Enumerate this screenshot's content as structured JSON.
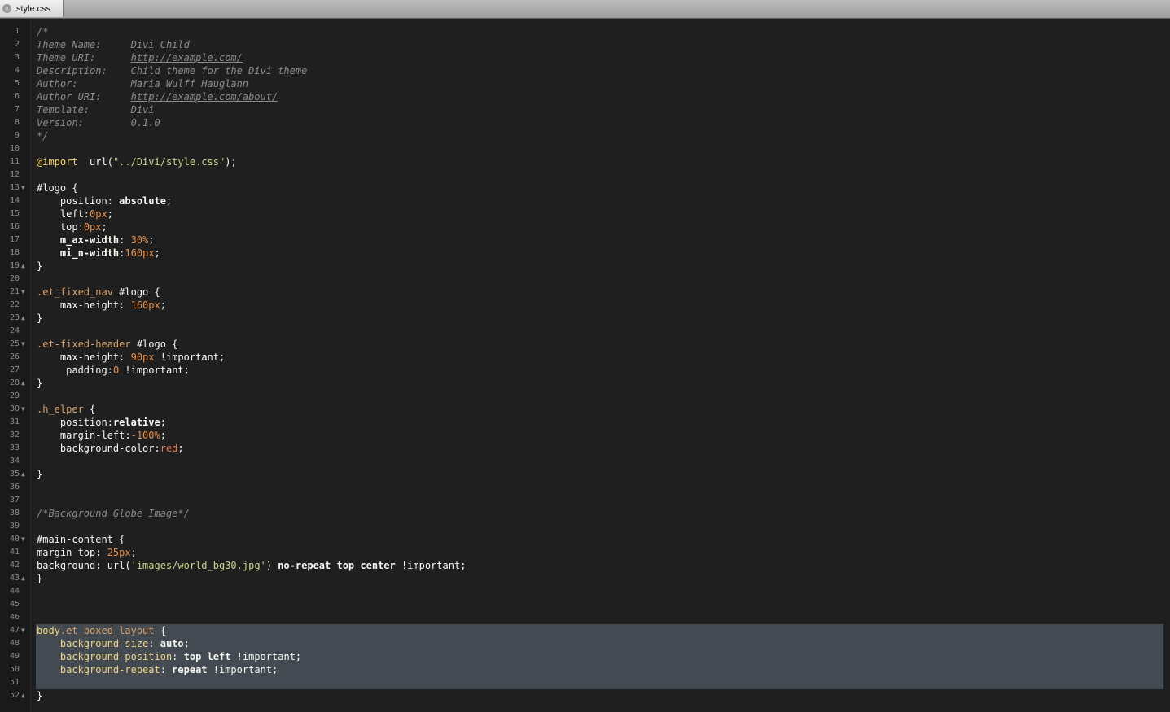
{
  "tab": {
    "title": "style.css",
    "close_glyph": "×"
  },
  "editor": {
    "line_count": 52,
    "fold_open_lines": [
      13,
      21,
      25,
      30,
      40,
      47
    ],
    "fold_close_lines": [
      19,
      23,
      28,
      35,
      43,
      52
    ],
    "selection_lines": [
      47,
      51
    ],
    "lines": [
      {
        "n": 1,
        "t": [
          [
            "c",
            "/*"
          ]
        ]
      },
      {
        "n": 2,
        "t": [
          [
            "c",
            "Theme Name:     Divi Child"
          ]
        ]
      },
      {
        "n": 3,
        "t": [
          [
            "c",
            "Theme URI:      "
          ],
          [
            "c u",
            "http://example.com/"
          ]
        ]
      },
      {
        "n": 4,
        "t": [
          [
            "c",
            "Description:    Child theme for the Divi theme"
          ]
        ]
      },
      {
        "n": 5,
        "t": [
          [
            "c",
            "Author:         Maria Wulff Hauglann"
          ]
        ]
      },
      {
        "n": 6,
        "t": [
          [
            "c",
            "Author URI:     "
          ],
          [
            "c u",
            "http://example.com/about/"
          ]
        ]
      },
      {
        "n": 7,
        "t": [
          [
            "c",
            "Template:       Divi"
          ]
        ]
      },
      {
        "n": 8,
        "t": [
          [
            "c",
            "Version:        0.1.0"
          ]
        ]
      },
      {
        "n": 9,
        "t": [
          [
            "c",
            "*/"
          ]
        ]
      },
      {
        "n": 10,
        "t": []
      },
      {
        "n": 11,
        "t": [
          [
            "at",
            "@import"
          ],
          [
            "",
            "  url("
          ],
          [
            "s",
            "\"../Divi/style.css\""
          ],
          [
            "",
            ");"
          ]
        ]
      },
      {
        "n": 12,
        "t": []
      },
      {
        "n": 13,
        "t": [
          [
            "sel-id",
            "#logo"
          ],
          [
            "",
            " {"
          ]
        ]
      },
      {
        "n": 14,
        "t": [
          [
            "prop",
            "    position"
          ],
          [
            "",
            ": "
          ],
          [
            "val",
            "absolute"
          ],
          [
            "",
            ";"
          ]
        ]
      },
      {
        "n": 15,
        "t": [
          [
            "prop",
            "    left"
          ],
          [
            "",
            ":"
          ],
          [
            "num",
            "0px"
          ],
          [
            "",
            ";"
          ]
        ]
      },
      {
        "n": 16,
        "t": [
          [
            "prop",
            "    top"
          ],
          [
            "",
            ":"
          ],
          [
            "num",
            "0px"
          ],
          [
            "",
            ";"
          ]
        ]
      },
      {
        "n": 17,
        "t": [
          [
            "val",
            "    m_ax-width"
          ],
          [
            "",
            ": "
          ],
          [
            "num",
            "30%"
          ],
          [
            "",
            ";"
          ]
        ]
      },
      {
        "n": 18,
        "t": [
          [
            "val",
            "    mi_n-width"
          ],
          [
            "",
            ":"
          ],
          [
            "num",
            "160px"
          ],
          [
            "",
            ";"
          ]
        ]
      },
      {
        "n": 19,
        "t": [
          [
            "",
            "}"
          ]
        ]
      },
      {
        "n": 20,
        "t": []
      },
      {
        "n": 21,
        "t": [
          [
            "cls",
            ".et_fixed_nav"
          ],
          [
            "sel-id",
            " #logo"
          ],
          [
            "",
            " {"
          ]
        ]
      },
      {
        "n": 22,
        "t": [
          [
            "prop",
            "    max-height"
          ],
          [
            "",
            ": "
          ],
          [
            "num",
            "160px"
          ],
          [
            "",
            ";"
          ]
        ]
      },
      {
        "n": 23,
        "t": [
          [
            "",
            "}"
          ]
        ]
      },
      {
        "n": 24,
        "t": []
      },
      {
        "n": 25,
        "t": [
          [
            "cls",
            ".et-fixed-header"
          ],
          [
            "sel-id",
            " #logo"
          ],
          [
            "",
            " {"
          ]
        ]
      },
      {
        "n": 26,
        "t": [
          [
            "prop",
            "    max-height"
          ],
          [
            "",
            ": "
          ],
          [
            "num",
            "90px"
          ],
          [
            "imp",
            " !important"
          ],
          [
            "",
            ";"
          ]
        ]
      },
      {
        "n": 27,
        "t": [
          [
            "prop",
            "     padding"
          ],
          [
            "",
            ":"
          ],
          [
            "num",
            "0"
          ],
          [
            "imp",
            " !important"
          ],
          [
            "",
            ";"
          ]
        ]
      },
      {
        "n": 28,
        "t": [
          [
            "",
            "}"
          ]
        ]
      },
      {
        "n": 29,
        "t": []
      },
      {
        "n": 30,
        "t": [
          [
            "cls",
            ".h_elper"
          ],
          [
            "",
            " {"
          ]
        ]
      },
      {
        "n": 31,
        "t": [
          [
            "prop",
            "    position"
          ],
          [
            "",
            ":"
          ],
          [
            "val",
            "relative"
          ],
          [
            "",
            ";"
          ]
        ]
      },
      {
        "n": 32,
        "t": [
          [
            "prop",
            "    margin-left"
          ],
          [
            "",
            ":"
          ],
          [
            "num",
            "-100%"
          ],
          [
            "",
            ";"
          ]
        ]
      },
      {
        "n": 33,
        "t": [
          [
            "prop",
            "    background-color"
          ],
          [
            "",
            ":"
          ],
          [
            "red",
            "red"
          ],
          [
            "",
            ";"
          ]
        ]
      },
      {
        "n": 34,
        "t": []
      },
      {
        "n": 35,
        "t": [
          [
            "",
            "}"
          ]
        ]
      },
      {
        "n": 36,
        "t": []
      },
      {
        "n": 37,
        "t": []
      },
      {
        "n": 38,
        "t": [
          [
            "c",
            "/*Background Globe Image*/"
          ]
        ]
      },
      {
        "n": 39,
        "t": []
      },
      {
        "n": 40,
        "t": [
          [
            "sel-id",
            "#main-content"
          ],
          [
            "",
            " {"
          ]
        ]
      },
      {
        "n": 41,
        "t": [
          [
            "prop",
            "margin-top"
          ],
          [
            "",
            ": "
          ],
          [
            "num",
            "25px"
          ],
          [
            "",
            ";"
          ]
        ]
      },
      {
        "n": 42,
        "t": [
          [
            "prop",
            "background"
          ],
          [
            "",
            ": url("
          ],
          [
            "s",
            "'images/world_bg30.jpg'"
          ],
          [
            "",
            ") "
          ],
          [
            "val",
            "no-repeat top center"
          ],
          [
            "imp",
            " !important"
          ],
          [
            "",
            ";"
          ]
        ]
      },
      {
        "n": 43,
        "t": [
          [
            "",
            "}"
          ]
        ]
      },
      {
        "n": 44,
        "t": []
      },
      {
        "n": 45,
        "t": []
      },
      {
        "n": 46,
        "t": []
      },
      {
        "n": 47,
        "t": [
          [
            "tag",
            "body"
          ],
          [
            "cls",
            ".et_boxed_layout"
          ],
          [
            "",
            " {"
          ]
        ]
      },
      {
        "n": 48,
        "t": [
          [
            "prop2",
            "    background-size"
          ],
          [
            "",
            ": "
          ],
          [
            "val",
            "auto"
          ],
          [
            "",
            ";"
          ]
        ]
      },
      {
        "n": 49,
        "t": [
          [
            "prop2",
            "    background-position"
          ],
          [
            "",
            ": "
          ],
          [
            "val",
            "top left"
          ],
          [
            "imp",
            " !important"
          ],
          [
            "",
            ";"
          ]
        ]
      },
      {
        "n": 50,
        "t": [
          [
            "prop2",
            "    background-repeat"
          ],
          [
            "",
            ": "
          ],
          [
            "val",
            "repeat"
          ],
          [
            "imp",
            " !important"
          ],
          [
            "",
            ";"
          ]
        ]
      },
      {
        "n": 51,
        "t": []
      },
      {
        "n": 52,
        "t": [
          [
            "",
            "}"
          ]
        ]
      }
    ]
  },
  "colors": {
    "background": "#1f1f1f",
    "gutter": "#1a1a1a",
    "selection": "#434a52"
  }
}
